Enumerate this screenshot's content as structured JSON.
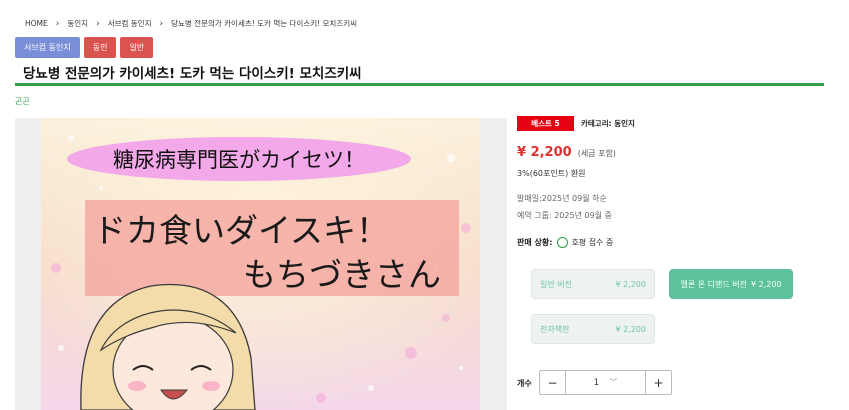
{
  "breadcrumb": [
    "HOME",
    "동인지",
    "서브컴 동인지",
    "당뇨병 전문의가 카이세츠! 도카 먹는 다이스키! 모치즈키씨"
  ],
  "tags": [
    "서브컴 동인지",
    "동인",
    "일반"
  ],
  "title": "당뇨병 전문의가 카이세츠! 도카 먹는 다이스키! 모치즈키씨",
  "author": "곤곤",
  "cover": {
    "line1": "糖尿病専門医がカイセツ！",
    "line2": "ドカ食いダイスキ！",
    "line3": "もちづきさん"
  },
  "info": {
    "best_badge": "베스트 5",
    "category": "카테고리: 동인지",
    "price": "¥ 2,200",
    "tax": "(세금 포함)",
    "points": "3%(60포인트) 환원",
    "release": "발매일:2025년 09월 하순",
    "reserve": "예약 그룹: 2025년 09월 중",
    "status_label": "판매 상황:",
    "status_text": "호평 접수 중"
  },
  "versions": [
    {
      "label": "일반 버전",
      "price": "¥ 2,200"
    },
    {
      "label": "멜론 온 디맨드 버전",
      "price": "¥ 2,200"
    },
    {
      "label": "전자책판",
      "price": "¥ 2,200"
    }
  ],
  "quantity": {
    "label": "개수",
    "value": "1",
    "minus": "−",
    "plus": "+"
  },
  "colors": {
    "accent_green": "#2f9e44",
    "price_red": "#e03131",
    "badge_red": "#e60012",
    "tag_blue": "#7b8fd8",
    "active_version": "#5cc29b"
  }
}
